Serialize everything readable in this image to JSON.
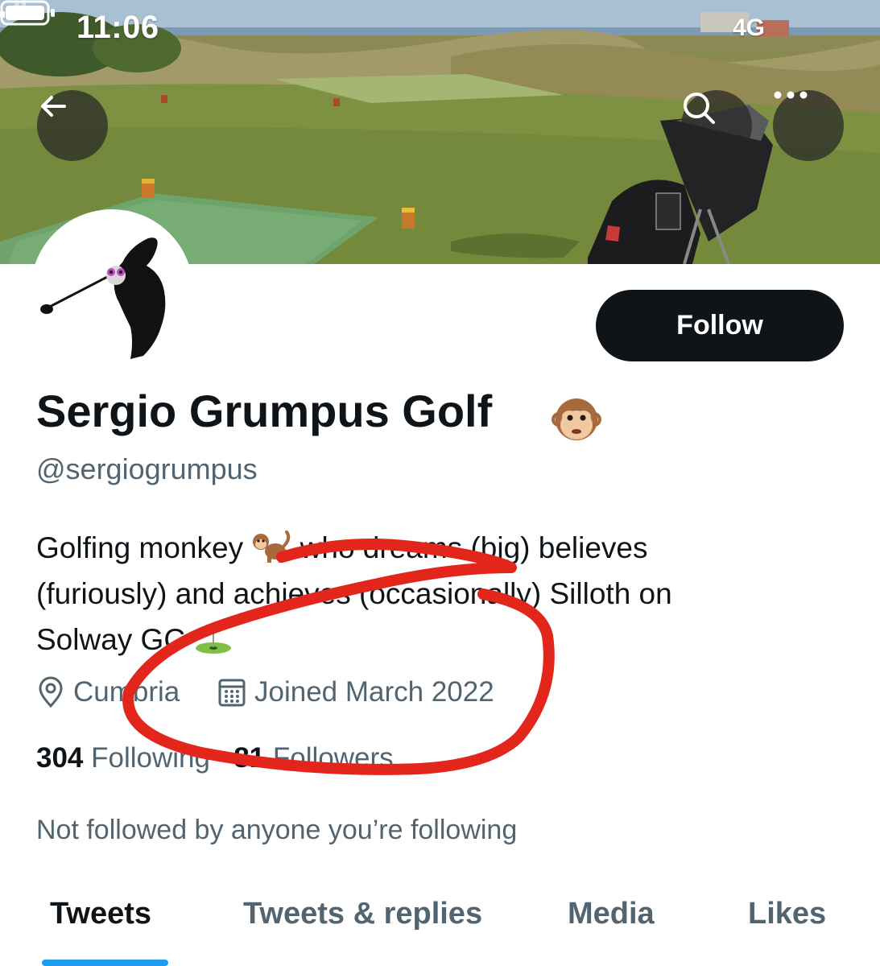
{
  "status_bar": {
    "time": "11:06",
    "network": "4G"
  },
  "header": {
    "back_icon": "arrow-left-icon",
    "search_icon": "search-icon",
    "more_icon": "more-horizontal-icon"
  },
  "profile": {
    "display_name": "Sergio Grumpus Golf",
    "name_emoji": "see-no-evil-monkey-face",
    "handle": "@sergiogrumpus",
    "follow_label": "Follow",
    "bio_lines": [
      "Golfing monkey",
      "who dreams (big) believes",
      "(furiously) and achieves (occasionally) Silloth on",
      "Solway GC"
    ],
    "bio_emojis": [
      "monkey",
      "flag-in-hole"
    ],
    "location": "Cumbria",
    "location_icon": "location-pin-icon",
    "joined": "Joined March 2022",
    "joined_icon": "calendar-icon",
    "following_count": "304",
    "following_label": "Following",
    "followers_count": "81",
    "followers_label": "Followers",
    "not_followed_text": "Not followed by anyone you’re following"
  },
  "tabs": [
    {
      "label": "Tweets",
      "active": true
    },
    {
      "label": "Tweets & replies",
      "active": false
    },
    {
      "label": "Media",
      "active": false
    },
    {
      "label": "Likes",
      "active": false
    }
  ],
  "colors": {
    "primary_text": "#0f1419",
    "secondary_text": "#536471",
    "accent": "#1d9bf0",
    "follow_button_bg": "#0f1419",
    "annotation_red": "#e3261c"
  }
}
